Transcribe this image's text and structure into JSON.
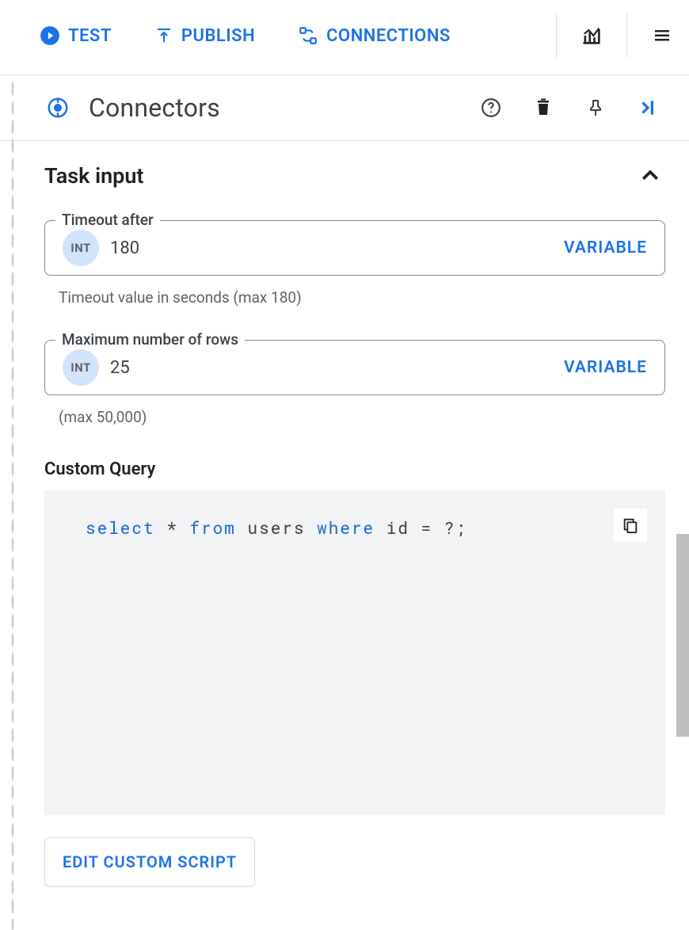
{
  "toolbar": {
    "test": "TEST",
    "publish": "PUBLISH",
    "connections": "CONNECTIONS"
  },
  "panel": {
    "title": "Connectors"
  },
  "section": {
    "title": "Task input"
  },
  "fields": {
    "timeout": {
      "legend": "Timeout after",
      "type": "INT",
      "value": "180",
      "action": "VARIABLE",
      "hint": "Timeout value in seconds (max 180)"
    },
    "rows": {
      "legend": "Maximum number of rows",
      "type": "INT",
      "value": "25",
      "action": "VARIABLE",
      "hint": "(max 50,000)"
    }
  },
  "query": {
    "label": "Custom Query",
    "tokens": {
      "select": "select",
      "star": "*",
      "from": "from",
      "table": "users",
      "where": "where",
      "rest": "id = ?;"
    }
  },
  "buttons": {
    "edit": "EDIT CUSTOM SCRIPT"
  },
  "icons": {
    "play": "play-circle-icon",
    "upload": "upload-icon",
    "connections": "connections-icon",
    "chart": "chart-icon",
    "menu": "menu-icon",
    "connector_node": "connector-node-icon",
    "help": "help-icon",
    "delete": "delete-icon",
    "pin": "pin-icon",
    "collapse": "collapse-right-icon",
    "chevron_up": "chevron-up-icon",
    "copy": "copy-icon"
  }
}
